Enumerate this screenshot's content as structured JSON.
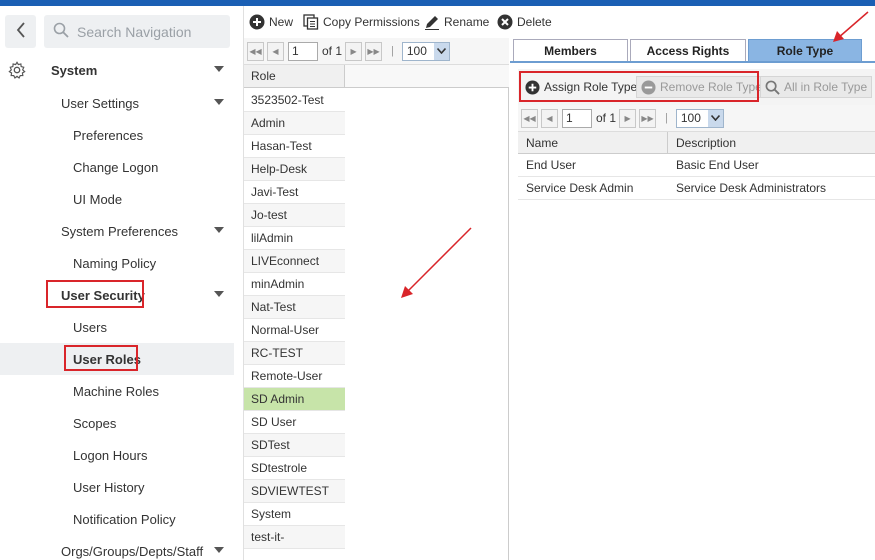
{
  "search": {
    "placeholder": "Search Navigation"
  },
  "nav": {
    "system": "System",
    "user_settings": "User Settings",
    "preferences": "Preferences",
    "change_logon": "Change Logon",
    "ui_mode": "UI Mode",
    "system_preferences": "System Preferences",
    "naming_policy": "Naming Policy",
    "user_security": "User Security",
    "users": "Users",
    "user_roles": "User Roles",
    "machine_roles": "Machine Roles",
    "scopes": "Scopes",
    "logon_hours": "Logon Hours",
    "user_history": "User History",
    "notification_policy": "Notification Policy",
    "orgs": "Orgs/Groups/Depts/Staff"
  },
  "toolbar": {
    "new": "New",
    "copy_permissions": "Copy Permissions",
    "rename": "Rename",
    "delete": "Delete"
  },
  "pager": {
    "page": "1",
    "of": "of 1",
    "sep": "|",
    "page_size": "100"
  },
  "roles": {
    "header": "Role",
    "items": [
      "3523502-Test",
      "Admin",
      "Hasan-Test",
      "Help-Desk",
      "Javi-Test",
      "Jo-test",
      "lilAdmin",
      "LIVEconnect",
      "minAdmin",
      "Nat-Test",
      "Normal-User",
      "RC-TEST",
      "Remote-User",
      "SD Admin",
      "SD User",
      "SDTest",
      "SDtestrole",
      "SDVIEWTEST",
      "System",
      "test-it-"
    ],
    "selected": "SD Admin"
  },
  "tabs": {
    "members": "Members",
    "access_rights": "Access Rights",
    "role_type": "Role Type"
  },
  "role_type": {
    "assign": "Assign Role Type",
    "remove": "Remove Role Type",
    "all": "All in Role Type",
    "columns": {
      "name": "Name",
      "description": "Description"
    },
    "rows": [
      {
        "name": "End User",
        "description": "Basic End User"
      },
      {
        "name": "Service Desk Admin",
        "description": "Service Desk Administrators"
      }
    ]
  },
  "colors": {
    "accent": "#1a5fb4",
    "highlight": "#d9252a",
    "selected_row": "#c7e4a9",
    "active_tab": "#8ab5e3"
  }
}
